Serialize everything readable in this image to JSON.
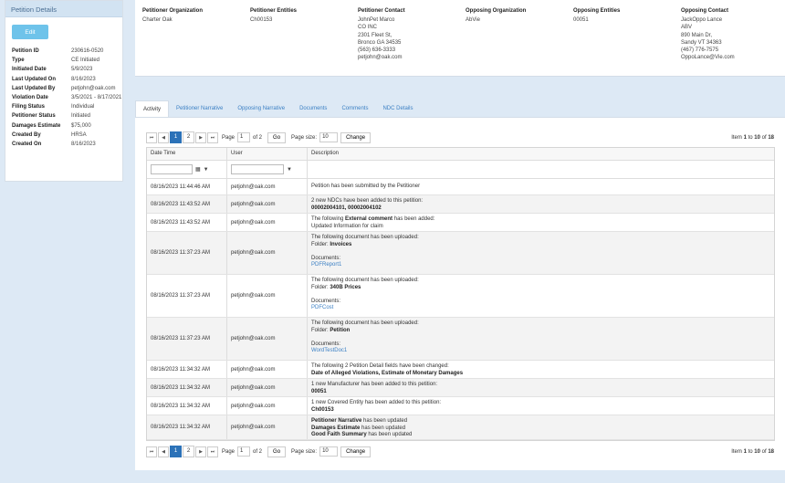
{
  "left_panel": {
    "title": "Petition Details",
    "edit_label": "Edit",
    "details": [
      {
        "label": "Petition ID",
        "value": "230616-0520"
      },
      {
        "label": "Type",
        "value": "CE Initiated"
      },
      {
        "label": "Initiated Date",
        "value": "5/9/2023"
      },
      {
        "label": "Last Updated On",
        "value": "8/16/2023"
      },
      {
        "label": "Last Updated By",
        "value": "petjohn@oak.com"
      },
      {
        "label": "Violation Date",
        "value": "3/5/2021 - 8/17/2021"
      },
      {
        "label": "Filing Status",
        "value": "Individual"
      },
      {
        "label": "Petitioner Status",
        "value": "Initiated"
      },
      {
        "label": "Damages Estimate",
        "value": "$75,000"
      },
      {
        "label": "Created By",
        "value": "HRSA"
      },
      {
        "label": "Created On",
        "value": "8/16/2023"
      }
    ]
  },
  "info": {
    "petitioner_org": {
      "header": "Petitioner Organization",
      "lines": [
        "Charter Oak"
      ]
    },
    "petitioner_entities": {
      "header": "Petitioner Entities",
      "lines": [
        "Ch00153"
      ]
    },
    "petitioner_contact": {
      "header": "Petitioner Contact",
      "lines": [
        "JohnPet Marco",
        "CO INC",
        "2301 Fleet St,",
        "Bronco GA 34535",
        "(563) 636-3333",
        "petjohn@oak.com"
      ]
    },
    "opposing_org": {
      "header": "Opposing Organization",
      "lines": [
        "AbVie"
      ]
    },
    "opposing_entities": {
      "header": "Opposing Entities",
      "lines": [
        "00051"
      ]
    },
    "opposing_contact": {
      "header": "Opposing Contact",
      "lines": [
        "JackOppo Lance",
        "ABV",
        "890 Main Dr,",
        "Sandy VT 34363",
        "(467) 776-7575",
        "OppoLance@Vie.com"
      ]
    }
  },
  "tabs": [
    "Activity",
    "Petitioner Narrative",
    "Opposing Narrative",
    "Documents",
    "Comments",
    "NDC Details"
  ],
  "pager": {
    "first": "⏮",
    "prev": "◀",
    "pages": [
      "1",
      "2"
    ],
    "next": "▶",
    "last": "⏭",
    "page_label": "Page",
    "page_value": "1",
    "of_label": "of 2",
    "go_label": "Go",
    "size_label": "Page size:",
    "size_value": "10",
    "change_label": "Change",
    "item_prefix": "Item",
    "item_from": "1",
    "item_to_word": "to",
    "item_to": "10",
    "item_of_word": "of",
    "item_total": "18"
  },
  "columns": [
    "Date Time",
    "User",
    "Description"
  ],
  "rows": [
    {
      "date": "08/16/2023 11:44:46 AM",
      "user": "petjohn@oak.com",
      "lines": [
        {
          "t": "Petition has been submitted by the Petitioner"
        }
      ]
    },
    {
      "date": "08/16/2023 11:43:52 AM",
      "user": "petjohn@oak.com",
      "lines": [
        {
          "t": "2 new NDCs have been added to this petition:"
        },
        {
          "t": "00002004101, 00002004102",
          "b": true
        }
      ]
    },
    {
      "date": "08/16/2023 11:43:52 AM",
      "user": "petjohn@oak.com",
      "lines": [
        {
          "t": "The following ",
          "bold": "External comment",
          "after": " has been added:"
        },
        {
          "t": "Updated Information for claim"
        }
      ]
    },
    {
      "date": "08/16/2023 11:37:23 AM",
      "user": "petjohn@oak.com",
      "lines": [
        {
          "t": "The following document has been uploaded:"
        },
        {
          "t": "Folder: ",
          "bold": "Invoices"
        },
        {
          "t": ""
        },
        {
          "t": "Documents:"
        },
        {
          "t": "PDFReport1",
          "link": true
        }
      ]
    },
    {
      "date": "08/16/2023 11:37:23 AM",
      "user": "petjohn@oak.com",
      "lines": [
        {
          "t": "The following document has been uploaded:"
        },
        {
          "t": "Folder: ",
          "bold": "340B Prices"
        },
        {
          "t": ""
        },
        {
          "t": "Documents:"
        },
        {
          "t": "PDFCost",
          "link": true
        }
      ]
    },
    {
      "date": "08/16/2023 11:37:23 AM",
      "user": "petjohn@oak.com",
      "lines": [
        {
          "t": "The following document has been uploaded:"
        },
        {
          "t": "Folder: ",
          "bold": "Petition"
        },
        {
          "t": ""
        },
        {
          "t": "Documents:"
        },
        {
          "t": "WordTestDoc1",
          "link": true
        }
      ]
    },
    {
      "date": "08/16/2023 11:34:32 AM",
      "user": "petjohn@oak.com",
      "lines": [
        {
          "t": "The following 2 Petition Detail fields have been changed:"
        },
        {
          "t": "Date of Alleged Violations, Estimate of Monetary Damages",
          "b": true
        }
      ]
    },
    {
      "date": "08/16/2023 11:34:32 AM",
      "user": "petjohn@oak.com",
      "lines": [
        {
          "t": "1 new Manufacturer has been added to this petition:"
        },
        {
          "t": "00051",
          "b": true
        }
      ]
    },
    {
      "date": "08/16/2023 11:34:32 AM",
      "user": "petjohn@oak.com",
      "lines": [
        {
          "t": "1 new Covered Entity has been added to this petition:"
        },
        {
          "t": "Ch00153",
          "b": true
        }
      ]
    },
    {
      "date": "08/16/2023 11:34:32 AM",
      "user": "petjohn@oak.com",
      "lines": [
        {
          "t": "",
          "bold": "Petitioner Narrative",
          "after": " has been updated"
        },
        {
          "t": "",
          "bold": "Damages Estimate",
          "after": " has been updated"
        },
        {
          "t": "",
          "bold": "Good Faith Summary",
          "after": " has been updated"
        }
      ]
    }
  ]
}
